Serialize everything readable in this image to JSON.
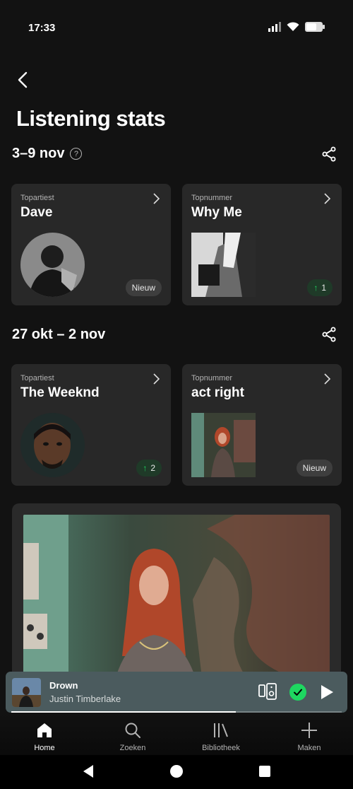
{
  "status_bar": {
    "time": "17:33"
  },
  "header": {
    "title": "Listening stats"
  },
  "sections": [
    {
      "date_range": "3–9 nov",
      "cards": [
        {
          "label": "Topartiest",
          "title": "Dave",
          "badge": "Nieuw",
          "badge_type": "new"
        },
        {
          "label": "Topnummer",
          "title": "Why Me",
          "badge": "1",
          "badge_type": "up"
        }
      ]
    },
    {
      "date_range": "27 okt – 2 nov",
      "cards": [
        {
          "label": "Topartiest",
          "title": "The Weeknd",
          "badge": "2",
          "badge_type": "up"
        },
        {
          "label": "Topnummer",
          "title": "act right",
          "badge": "Nieuw",
          "badge_type": "new"
        }
      ]
    }
  ],
  "mini_player": {
    "title": "Drown",
    "artist": "Justin Timberlake",
    "progress": 0.68
  },
  "bottom_nav": [
    {
      "label": "Home",
      "icon": "home-icon",
      "active": true
    },
    {
      "label": "Zoeken",
      "icon": "search-icon",
      "active": false
    },
    {
      "label": "Bibliotheek",
      "icon": "library-icon",
      "active": false
    },
    {
      "label": "Maken",
      "icon": "plus-icon",
      "active": false
    }
  ],
  "colors": {
    "background": "#121212",
    "card": "#282828",
    "accent_green": "#1ed760",
    "mini_player": "#4b5b5e"
  }
}
